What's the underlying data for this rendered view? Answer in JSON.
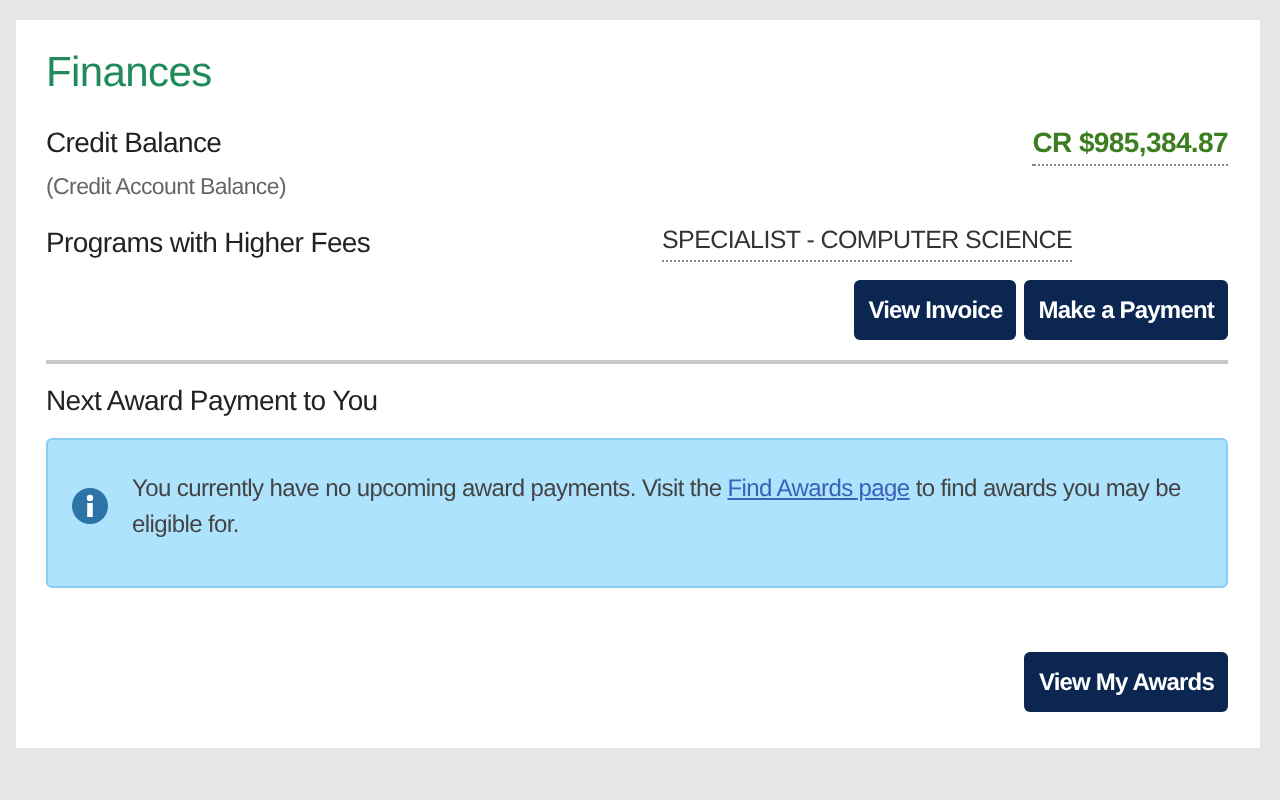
{
  "title": "Finances",
  "credit": {
    "label": "Credit Balance",
    "sublabel": "(Credit Account Balance)",
    "value": "CR $985,384.87"
  },
  "programs": {
    "label": "Programs with Higher Fees",
    "value": "SPECIALIST - COMPUTER SCIENCE"
  },
  "actions": [
    "View Invoice",
    "Make a Payment"
  ],
  "awards": {
    "heading": "Next Award Payment to You",
    "message": {
      "before": "You currently have no upcoming award payments. Visit the",
      "link": "Find Awards page",
      "after": "to find awards you may be eligible for."
    },
    "button": "View My Awards"
  }
}
